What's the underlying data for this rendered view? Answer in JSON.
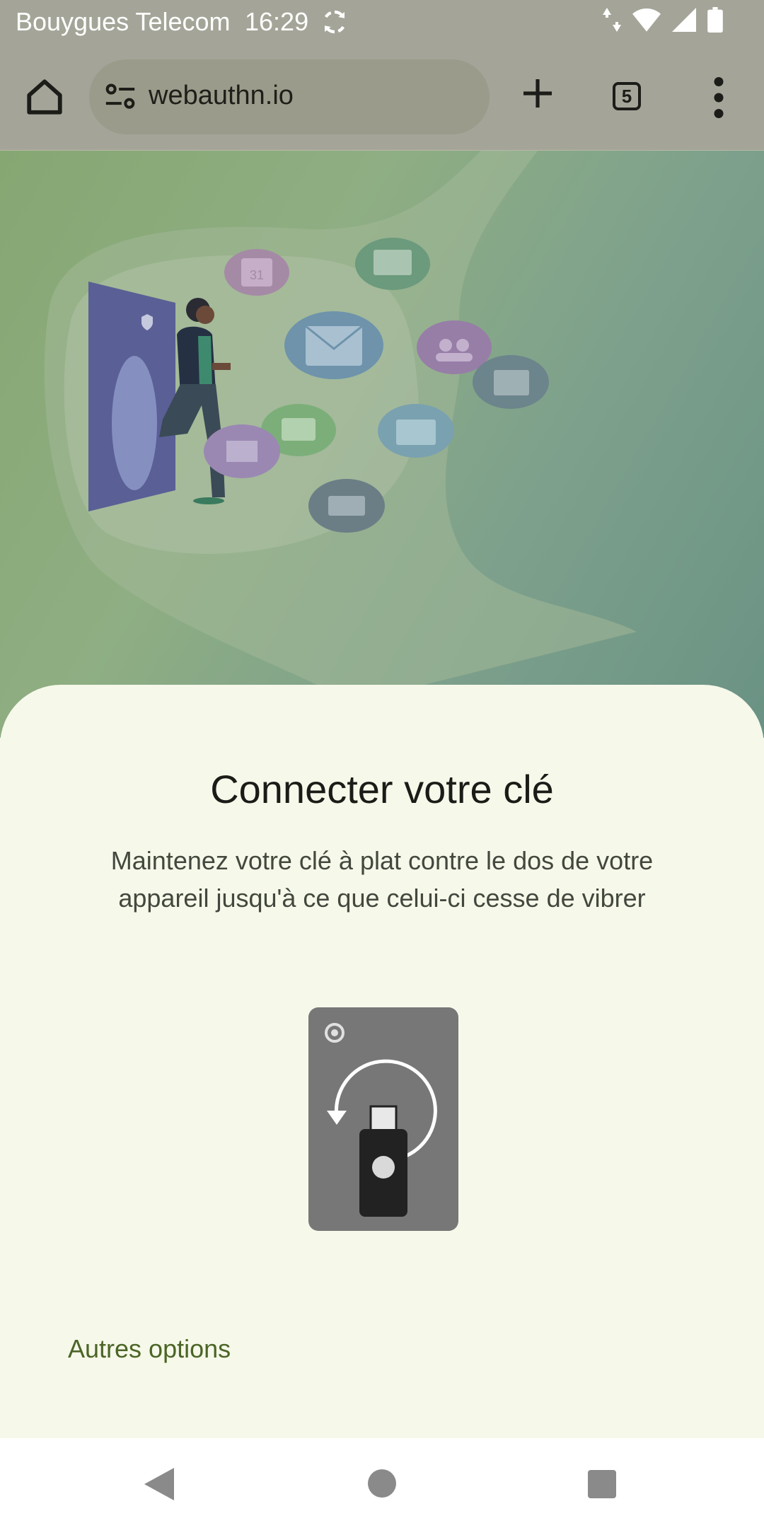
{
  "status_bar": {
    "carrier": "Bouygues Telecom",
    "time": "16:29",
    "icons": [
      "sync-icon",
      "data-arrows-icon",
      "wifi-icon",
      "signal-icon",
      "battery-icon"
    ]
  },
  "browser": {
    "url": "webauthn.io",
    "tab_count": "5",
    "icons": [
      "home-icon",
      "site-settings-icon",
      "new-tab-icon",
      "tab-switcher-icon",
      "overflow-menu-icon"
    ]
  },
  "web_illustration": {
    "calendar_day": "31"
  },
  "sheet": {
    "title": "Connecter votre clé",
    "description": "Maintenez votre clé à plat contre le dos de votre appareil jusqu'à ce que celui-ci cesse de vibrer",
    "other_options": "Autres options"
  },
  "colors": {
    "sheet_background": "#f6f8ea",
    "link_green": "#4b6526",
    "scrim_bar": "#a4a598"
  },
  "nav_bar": {
    "icons": [
      "back-icon",
      "home-circle-icon",
      "recents-icon"
    ]
  }
}
